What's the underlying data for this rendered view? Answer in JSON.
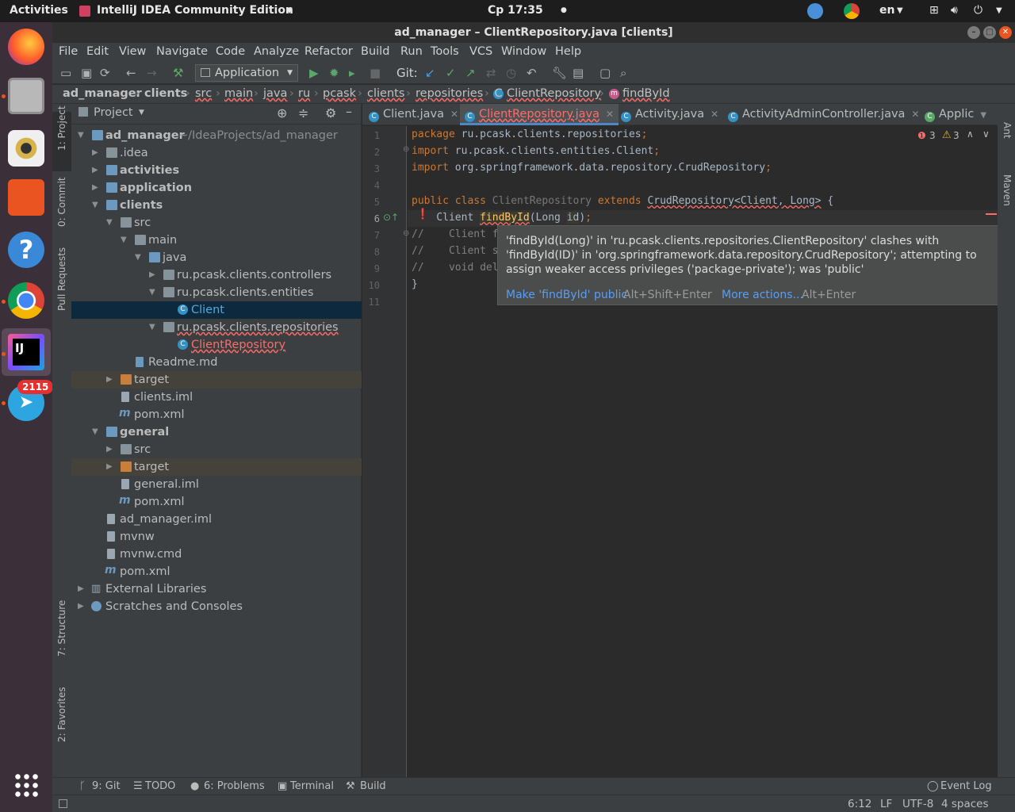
{
  "system": {
    "activities": "Activities",
    "app_menu": "IntelliJ IDEA Community Edition",
    "clock": "Ср 17:35",
    "lang": "en",
    "telegram_badge": "2115"
  },
  "window": {
    "title": "ad_manager – ClientRepository.java [clients]"
  },
  "menu": [
    "File",
    "Edit",
    "View",
    "Navigate",
    "Code",
    "Analyze",
    "Refactor",
    "Build",
    "Run",
    "Tools",
    "VCS",
    "Window",
    "Help"
  ],
  "toolbar": {
    "run_config": "Application",
    "git_label": "Git:"
  },
  "breadcrumbs": [
    "ad_manager",
    "clients",
    "src",
    "main",
    "java",
    "ru",
    "pcask",
    "clients",
    "repositories",
    "ClientRepository",
    "findById"
  ],
  "tool_windows_left": {
    "project": "1: Project",
    "commit": "0: Commit",
    "pull_requests": "Pull Requests",
    "structure": "7: Structure",
    "favorites": "2: Favorites"
  },
  "tool_windows_right": {
    "ant": "Ant",
    "maven": "Maven"
  },
  "project_panel": {
    "title": "Project",
    "tree": [
      {
        "label": "ad_manager",
        "extra": "~/IdeaProjects/ad_manager"
      },
      {
        "label": ".idea"
      },
      {
        "label": "activities"
      },
      {
        "label": "application"
      },
      {
        "label": "clients"
      },
      {
        "label": "src"
      },
      {
        "label": "main"
      },
      {
        "label": "java"
      },
      {
        "label": "ru.pcask.clients.controllers"
      },
      {
        "label": "ru.pcask.clients.entities"
      },
      {
        "label": "Client"
      },
      {
        "label": "ru.pcask.clients.repositories"
      },
      {
        "label": "ClientRepository"
      },
      {
        "label": "Readme.md"
      },
      {
        "label": "target"
      },
      {
        "label": "clients.iml"
      },
      {
        "label": "pom.xml"
      },
      {
        "label": "general"
      },
      {
        "label": "src"
      },
      {
        "label": "target"
      },
      {
        "label": "general.iml"
      },
      {
        "label": "pom.xml"
      },
      {
        "label": "ad_manager.iml"
      },
      {
        "label": "mvnw"
      },
      {
        "label": "mvnw.cmd"
      },
      {
        "label": "pom.xml"
      },
      {
        "label": "External Libraries"
      },
      {
        "label": "Scratches and Consoles"
      }
    ]
  },
  "editor": {
    "tabs": [
      "Client.java",
      "ClientRepository.java",
      "Activity.java",
      "ActivityAdminController.java",
      "Applic"
    ],
    "errors": "3",
    "warnings": "3",
    "lines": [
      {
        "n": "1",
        "t": "package ru.pcask.clients.repositories;"
      },
      {
        "n": "2",
        "t": "import ru.pcask.clients.entities.Client;"
      },
      {
        "n": "3",
        "t": "import org.springframework.data.repository.CrudRepository;"
      },
      {
        "n": "4",
        "t": ""
      },
      {
        "n": "5",
        "t": "public class ClientRepository extends CrudRepository<Client, Long> {"
      },
      {
        "n": "6",
        "t": "    Client findById(Long id);"
      },
      {
        "n": "7",
        "t": "//    Client f"
      },
      {
        "n": "8",
        "t": "//    Client s"
      },
      {
        "n": "9",
        "t": "//    void del"
      },
      {
        "n": "10",
        "t": "}"
      },
      {
        "n": "11",
        "t": ""
      }
    ]
  },
  "popup": {
    "message": "'findById(Long)' in 'ru.pcask.clients.repositories.ClientRepository' clashes with 'findById(ID)' in 'org.springframework.data.repository.CrudRepository'; attempting to assign weaker access privileges ('package-private'); was 'public'",
    "fix_action": "Make 'findById' public",
    "fix_shortcut": "Alt+Shift+Enter",
    "more_action": "More actions...",
    "more_shortcut": "Alt+Enter"
  },
  "bottom_tools": {
    "git": "9: Git",
    "todo": "TODO",
    "problems": "6: Problems",
    "terminal": "Terminal",
    "build": "Build",
    "event_log": "Event Log"
  },
  "status": {
    "position": "6:12",
    "line_sep": "LF",
    "encoding": "UTF-8",
    "indent": "4 spaces"
  },
  "colors": {
    "accent": "#4a88c7",
    "error": "#ff6b68",
    "link": "#589df6",
    "selection": "#0d293e"
  }
}
